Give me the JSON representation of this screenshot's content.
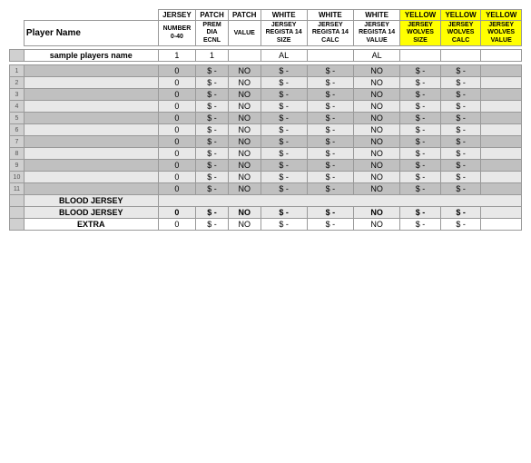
{
  "table": {
    "headers": {
      "row1": [
        {
          "label": "",
          "colspan": 1,
          "type": "rownum"
        },
        {
          "label": "",
          "colspan": 1,
          "type": "name"
        },
        {
          "label": "JERSEY",
          "colspan": 1,
          "type": "normal"
        },
        {
          "label": "PATCH",
          "colspan": 1,
          "type": "normal"
        },
        {
          "label": "PATCH",
          "colspan": 1,
          "type": "normal"
        },
        {
          "label": "WHITE",
          "colspan": 1,
          "type": "normal"
        },
        {
          "label": "WHITE",
          "colspan": 1,
          "type": "normal"
        },
        {
          "label": "WHITE",
          "colspan": 1,
          "type": "normal"
        },
        {
          "label": "YELLOW",
          "colspan": 1,
          "type": "yellow"
        },
        {
          "label": "YELLOW",
          "colspan": 1,
          "type": "yellow"
        },
        {
          "label": "YELLOW",
          "colspan": 1,
          "type": "yellow"
        }
      ],
      "row2": [
        {
          "label": "",
          "type": "rownum"
        },
        {
          "label": "Player Name",
          "type": "name"
        },
        {
          "label": "NUMBER\n0-40",
          "type": "normal"
        },
        {
          "label": "PREM\nDIA\nECNL",
          "type": "normal"
        },
        {
          "label": "VALUE",
          "type": "normal"
        },
        {
          "label": "JERSEY\nREGISTA 14\nSIZE",
          "type": "normal"
        },
        {
          "label": "JERSEY\nREGISTA 14\nCALC",
          "type": "normal"
        },
        {
          "label": "JERSEY\nREGISTA 14\nVALUE",
          "type": "normal"
        },
        {
          "label": "JERSEY\nWOLVES\nSIZE",
          "type": "yellow"
        },
        {
          "label": "JERSEY\nWOLVES\nCALC",
          "type": "yellow"
        },
        {
          "label": "JERSEY\nWOLVES\nVALUE",
          "type": "yellow"
        }
      ]
    },
    "sample_row": {
      "name": "sample players name",
      "jersey": "1",
      "patch": "1",
      "patch2": "",
      "white_size": "AL",
      "white_calc": "",
      "white_value": "AL",
      "yellow_size": "",
      "yellow_calc": "",
      "yellow_value": ""
    },
    "data_rows": [
      {
        "num": "1",
        "name": "",
        "jersey": "0",
        "patch": "$ -",
        "patch2": "NO",
        "w1": "$ -",
        "w2": "$ -",
        "w3": "NO",
        "y1": "$ -",
        "y2": "$ -",
        "y3": ""
      },
      {
        "num": "2",
        "name": "",
        "jersey": "0",
        "patch": "$ -",
        "patch2": "NO",
        "w1": "$ -",
        "w2": "$ -",
        "w3": "NO",
        "y1": "$ -",
        "y2": "$ -",
        "y3": ""
      },
      {
        "num": "3",
        "name": "",
        "jersey": "0",
        "patch": "$ -",
        "patch2": "NO",
        "w1": "$ -",
        "w2": "$ -",
        "w3": "NO",
        "y1": "$ -",
        "y2": "$ -",
        "y3": ""
      },
      {
        "num": "4",
        "name": "",
        "jersey": "0",
        "patch": "$ -",
        "patch2": "NO",
        "w1": "$ -",
        "w2": "$ -",
        "w3": "NO",
        "y1": "$ -",
        "y2": "$ -",
        "y3": ""
      },
      {
        "num": "5",
        "name": "",
        "jersey": "0",
        "patch": "$ -",
        "patch2": "NO",
        "w1": "$ -",
        "w2": "$ -",
        "w3": "NO",
        "y1": "$ -",
        "y2": "$ -",
        "y3": ""
      },
      {
        "num": "6",
        "name": "",
        "jersey": "0",
        "patch": "$ -",
        "patch2": "NO",
        "w1": "$ -",
        "w2": "$ -",
        "w3": "NO",
        "y1": "$ -",
        "y2": "$ -",
        "y3": ""
      },
      {
        "num": "7",
        "name": "",
        "jersey": "0",
        "patch": "$ -",
        "patch2": "NO",
        "w1": "$ -",
        "w2": "$ -",
        "w3": "NO",
        "y1": "$ -",
        "y2": "$ -",
        "y3": ""
      },
      {
        "num": "8",
        "name": "",
        "jersey": "0",
        "patch": "$ -",
        "patch2": "NO",
        "w1": "$ -",
        "w2": "$ -",
        "w3": "NO",
        "y1": "$ -",
        "y2": "$ -",
        "y3": ""
      },
      {
        "num": "9",
        "name": "",
        "jersey": "0",
        "patch": "$ -",
        "patch2": "NO",
        "w1": "$ -",
        "w2": "$ -",
        "w3": "NO",
        "y1": "$ -",
        "y2": "$ -",
        "y3": ""
      },
      {
        "num": "10",
        "name": "",
        "jersey": "0",
        "patch": "$ -",
        "patch2": "NO",
        "w1": "$ -",
        "w2": "$ -",
        "w3": "NO",
        "y1": "$ -",
        "y2": "$ -",
        "y3": ""
      },
      {
        "num": "11",
        "name": "",
        "jersey": "0",
        "patch": "$ -",
        "patch2": "NO",
        "w1": "$ -",
        "w2": "$ -",
        "w3": "NO",
        "y1": "$ -",
        "y2": "$ -",
        "y3": ""
      }
    ],
    "special_rows": [
      {
        "type": "blood_label",
        "name": "BLOOD JERSEY",
        "jersey": "",
        "patch": "",
        "patch2": "",
        "w1": "",
        "w2": "",
        "w3": "",
        "y1": "",
        "y2": "",
        "y3": ""
      },
      {
        "type": "blood_data",
        "name": "BLOOD JERSEY",
        "jersey": "0",
        "patch": "$ -",
        "patch2": "NO",
        "w1": "$ -",
        "w2": "$ -",
        "w3": "NO",
        "y1": "$ -",
        "y2": "$ -",
        "y3": ""
      },
      {
        "type": "extra",
        "name": "EXTRA",
        "jersey": "0",
        "patch": "$ -",
        "patch2": "NO",
        "w1": "$ -",
        "w2": "$ -",
        "w3": "NO",
        "y1": "$ -",
        "y2": "$ -",
        "y3": ""
      }
    ]
  }
}
